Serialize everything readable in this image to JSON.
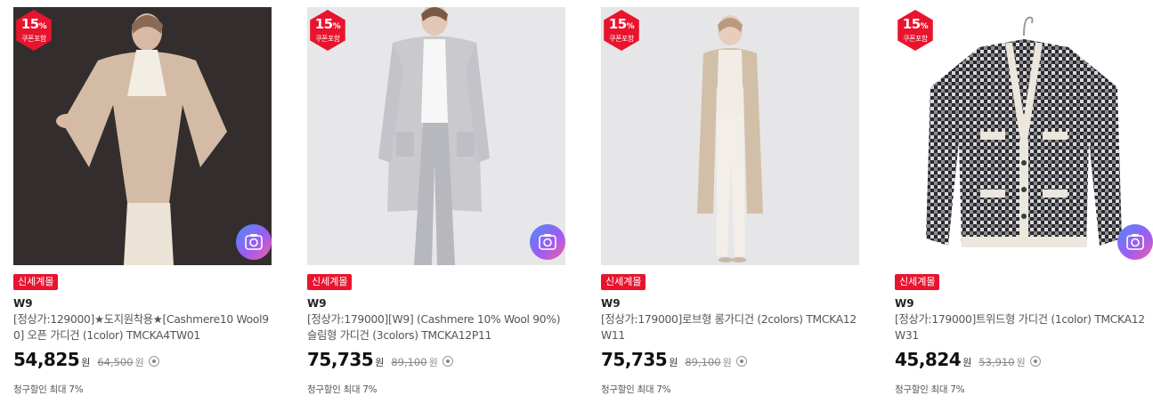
{
  "products": [
    {
      "badge_pct": "15",
      "badge_pct_unit": "%",
      "badge_sub": "쿠폰포함",
      "tag": "신세계몰",
      "brand": "W9",
      "name": "[정상가:129000]★도지원착용★[Cashmere10 Wool90] 오픈 가디건 (1color) TMCKA4TW01",
      "price": "54,825",
      "price_unit": "원",
      "original_price": "64,500",
      "original_unit": "원",
      "discount_note": "청구할인 최대 7%",
      "photo_icon": "camera-icon"
    },
    {
      "badge_pct": "15",
      "badge_pct_unit": "%",
      "badge_sub": "쿠폰포함",
      "tag": "신세계몰",
      "brand": "W9",
      "name": "[정상가:179000][W9] (Cashmere 10% Wool 90%) 슬림형 가디건 (3colors) TMCKA12P11",
      "price": "75,735",
      "price_unit": "원",
      "original_price": "89,100",
      "original_unit": "원",
      "discount_note": "청구할인 최대 7%",
      "photo_icon": "camera-icon"
    },
    {
      "badge_pct": "15",
      "badge_pct_unit": "%",
      "badge_sub": "쿠폰포함",
      "tag": "신세계몰",
      "brand": "W9",
      "name": "[정상가:179000]로브형 롱가디건 (2colors) TMCKA12W11",
      "price": "75,735",
      "price_unit": "원",
      "original_price": "89,100",
      "original_unit": "원",
      "discount_note": "청구할인 최대 7%",
      "photo_icon": "camera-icon"
    },
    {
      "badge_pct": "15",
      "badge_pct_unit": "%",
      "badge_sub": "쿠폰포함",
      "tag": "신세계몰",
      "brand": "W9",
      "name": "[정상가:179000]트위드형 가디건 (1color) TMCKA12W31",
      "price": "45,824",
      "price_unit": "원",
      "original_price": "53,910",
      "original_unit": "원",
      "discount_note": "청구할인 최대 7%",
      "photo_icon": "camera-icon"
    }
  ],
  "colors": {
    "badge_red": "#e8142e",
    "price_text": "#111111"
  }
}
